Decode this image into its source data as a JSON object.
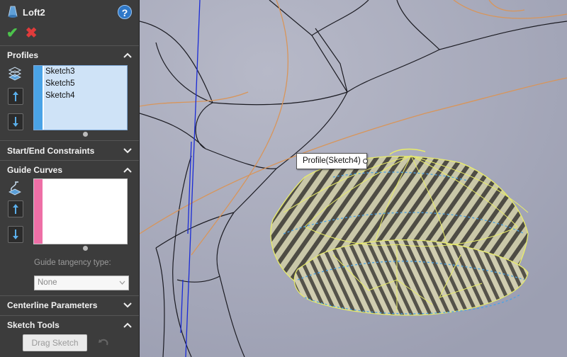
{
  "feature": {
    "title": "Loft2",
    "icon": "loft-icon",
    "help_icon": "help-icon",
    "help_glyph": "?"
  },
  "actions": {
    "ok_glyph": "✔",
    "cancel_glyph": "✖"
  },
  "profiles": {
    "header": "Profiles",
    "items": [
      "Sketch3",
      "Sketch5",
      "Sketch4"
    ]
  },
  "start_end": {
    "header": "Start/End Constraints"
  },
  "guide_curves": {
    "header": "Guide Curves",
    "items": [],
    "tangency_label": "Guide tangency type:",
    "tangency_value": "None"
  },
  "centerline": {
    "header": "Centerline Parameters"
  },
  "sketch_tools": {
    "header": "Sketch Tools",
    "drag_sketch_label": "Drag Sketch"
  },
  "viewport": {
    "tooltip": "Profile(Sketch4)",
    "background": "#a5a8b9",
    "colors": {
      "accent_blue": "#4aa3e6",
      "guide_pink": "#ee6fa6",
      "curve_orange": "#d8955a",
      "axis_blue": "#1a2bd6",
      "preview_yellow": "#e8ec6a"
    }
  }
}
